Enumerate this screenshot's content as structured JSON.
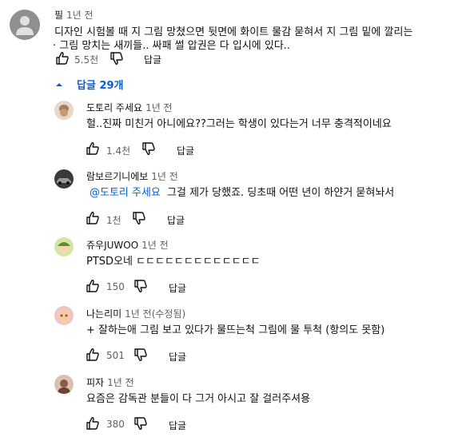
{
  "top_comment": {
    "author": "필",
    "time": "1년 전",
    "text_line1": "디자인 시험볼 때 지 그림 망쳤으면 뒷면에 화이트 물감 묻혀서 지 그림 밑에 깔리는",
    "text_line2": "· 그림 망치는 새끼들.. 싸패 썰 압권은 다 입시에 있다..",
    "likes": "5.5천",
    "reply_label": "답글"
  },
  "replies_toggle": {
    "label": "답글 29개"
  },
  "replies": [
    {
      "author": "도토리 주세요",
      "time": "1년 전",
      "mention": "",
      "text": "헐..진짜 미친거 아니에요??그러는 학생이 있다는거 너무 충격적이네요",
      "likes": "1.4천",
      "reply_label": "답글"
    },
    {
      "author": "람보르기니에보",
      "time": "1년 전",
      "mention": "@도토리 주세요",
      "text": "그걸 제가 당했죠. 딩초때 어떤 년이 하얀거 묻혀놔서",
      "likes": "1천",
      "reply_label": "답글"
    },
    {
      "author": "쥬우JUWOO",
      "time": "1년 전",
      "mention": "",
      "text": "PTSD오네 ㄷㄷㄷㄷㄷㄷㄷㄷㄷㄷㄷㄷㄷ",
      "likes": "150",
      "reply_label": "답글"
    },
    {
      "author": "나는리미",
      "time": "1년 전(수정됨)",
      "mention": "",
      "text": "+ 잘하는애 그림 보고 있다가 물뜨는척 그림에 물 투척 (항의도 못함)",
      "likes": "501",
      "reply_label": "답글"
    },
    {
      "author": "피자",
      "time": "1년 전",
      "mention": "",
      "text": "요즘은 감독관 분들이 다 그거 아시고 잘 걸러주셔용",
      "likes": "380",
      "reply_label": "답글"
    }
  ],
  "colors": {
    "link": "#065fd4",
    "muted": "#606060",
    "text": "#0f0f0f"
  }
}
